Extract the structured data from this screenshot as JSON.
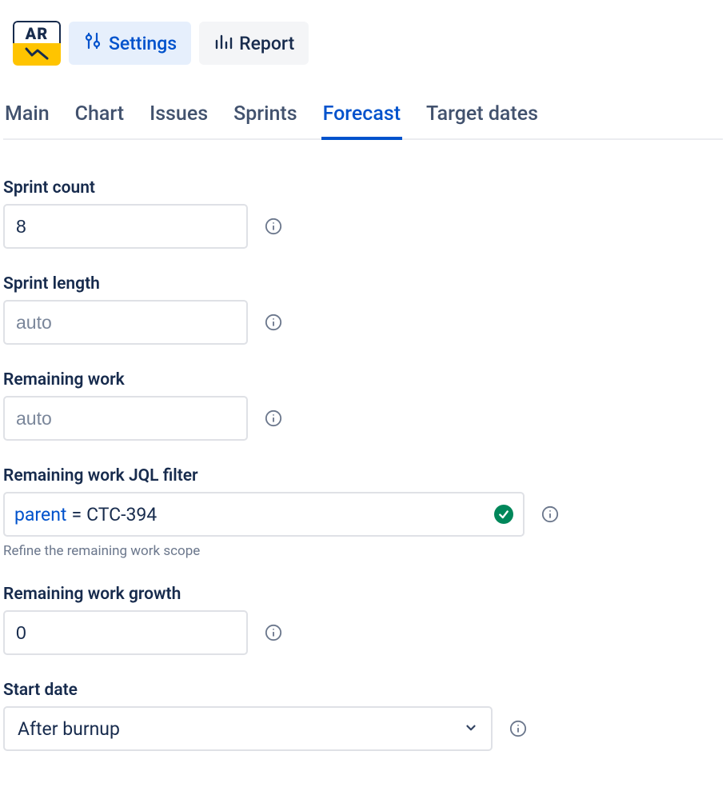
{
  "logo": {
    "text": "AR"
  },
  "toolbar": {
    "settings_label": "Settings",
    "report_label": "Report"
  },
  "tabs": {
    "main": "Main",
    "chart": "Chart",
    "issues": "Issues",
    "sprints": "Sprints",
    "forecast": "Forecast",
    "target_dates": "Target dates",
    "active": "forecast"
  },
  "fields": {
    "sprint_count": {
      "label": "Sprint count",
      "value": "8"
    },
    "sprint_length": {
      "label": "Sprint length",
      "placeholder": "auto",
      "value": ""
    },
    "remaining_work": {
      "label": "Remaining work",
      "placeholder": "auto",
      "value": ""
    },
    "jql": {
      "label": "Remaining work JQL filter",
      "key": "parent",
      "eq": "=",
      "value": "CTC-394",
      "valid": true,
      "helper": "Refine the remaining work scope"
    },
    "growth": {
      "label": "Remaining work growth",
      "value": "0"
    },
    "start_date": {
      "label": "Start date",
      "value": "After burnup"
    }
  }
}
